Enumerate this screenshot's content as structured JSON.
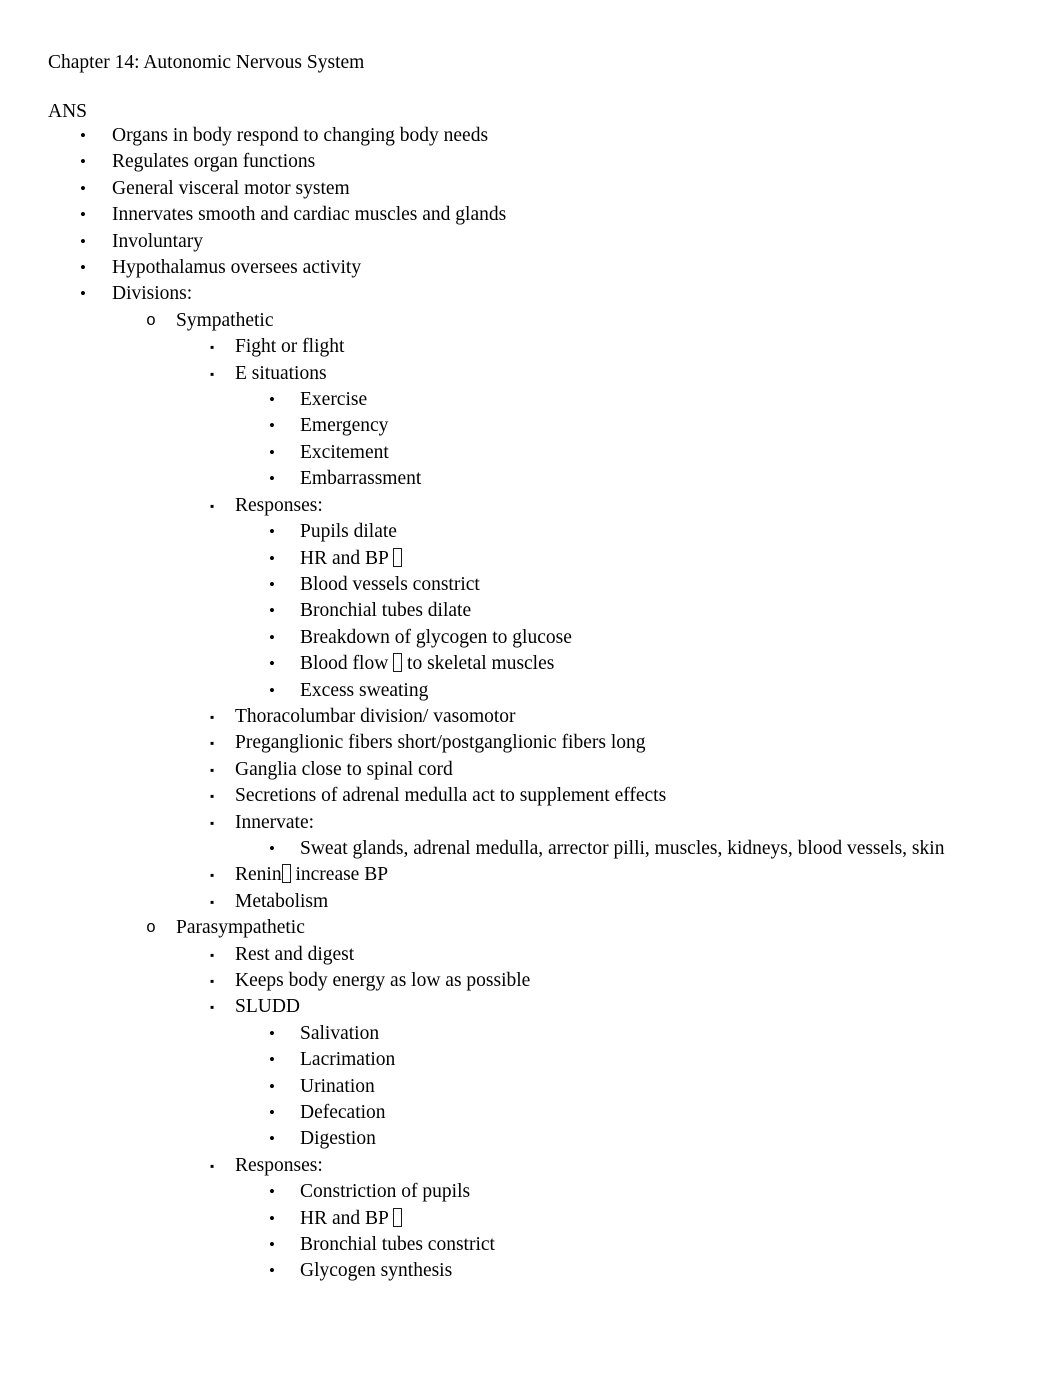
{
  "document": {
    "title": "Chapter 14: Autonomic Nervous System",
    "section_label": "ANS",
    "missing_glyph_placeholder": "□",
    "text_color": "#000000",
    "page_background": "#ffffff"
  },
  "bullets": {
    "level1_marker": "•",
    "level2_marker": "o",
    "level3_marker": "▪",
    "level4_marker": "•"
  },
  "outline": {
    "ans": [
      "Organs in body respond to changing body needs",
      "Regulates organ functions",
      "General visceral motor system",
      "Innervates smooth and cardiac muscles and glands",
      "Involuntary",
      "Hypothalamus oversees activity",
      "Divisions:"
    ],
    "sympathetic": {
      "heading": "Sympathetic",
      "items": [
        "Fight or flight",
        "E situations"
      ],
      "e_situations": [
        "Exercise",
        "Emergency",
        "Excitement",
        "Embarrassment"
      ],
      "responses_label": "Responses:",
      "responses": {
        "pupils_dilate": "Pupils dilate",
        "hr_and_bp_pre": "HR and BP ",
        "hr_and_bp_post": "",
        "blood_vessels": "Blood vessels constrict",
        "bronchial": "Bronchial tubes dilate",
        "glycogen": "Breakdown of glycogen to glucose",
        "blood_flow_pre": "Blood flow ",
        "blood_flow_post": " to skeletal muscles",
        "sweating": "Excess sweating"
      },
      "more_items": [
        "Thoracolumbar division/ vasomotor",
        "Preganglionic fibers short/postganglionic fibers long",
        "Ganglia close to spinal cord",
        "Secretions of adrenal medulla act to supplement effects",
        "Innervate:"
      ],
      "innervate_detail": "Sweat glands, adrenal medulla, arrector pilli, muscles, kidneys, blood vessels, skin",
      "renin_pre": "Renin",
      "renin_post": " increase BP",
      "metabolism": "Metabolism"
    },
    "parasympathetic": {
      "heading": "Parasympathetic",
      "items": [
        "Rest and digest",
        "Keeps body energy as low as possible",
        "SLUDD"
      ],
      "sludd": [
        "Salivation",
        "Lacrimation",
        "Urination",
        "Defecation",
        "Digestion"
      ],
      "responses_label": "Responses:",
      "responses": {
        "constriction": "Constriction of pupils",
        "hr_and_bp_pre": "HR and BP ",
        "hr_and_bp_post": "",
        "bronchial": "Bronchial tubes constrict",
        "glycogen": "Glycogen synthesis"
      }
    }
  }
}
